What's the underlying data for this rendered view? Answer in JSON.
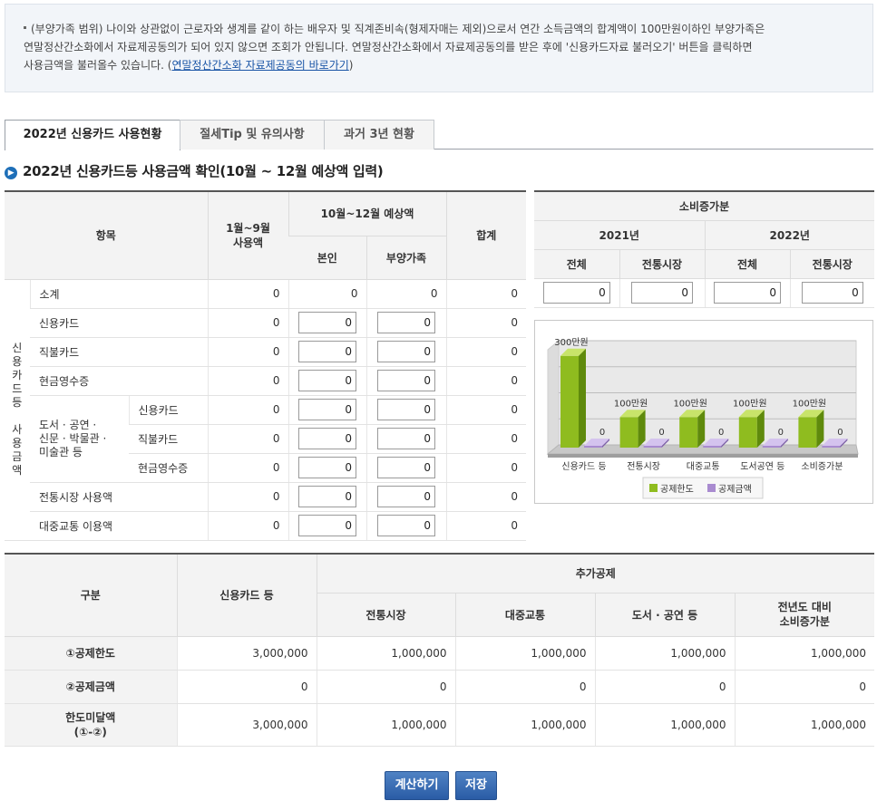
{
  "notice": {
    "line1": "(부양가족 범위) 나이와 상관없이 근로자와 생계를 같이 하는 배우자 및 직계존비속(형제자매는 제외)으로서 연간 소득금액의 합계액이 100만원이하인 부양가족은",
    "line2": "연말정산간소화에서 자료제공동의가 되어 있지 않으면 조회가 안됩니다. 연말정산간소화에서 자료제공동의를 받은 후에 '신용카드자료 불러오기' 버튼을 클릭하면",
    "line3_prefix": "사용금액을 불러올수 있습니다. (",
    "link": "연말정산간소화 자료제공동의 바로가기",
    "line3_suffix": ")"
  },
  "tabs": [
    {
      "label": "2022년 신용카드 사용현황",
      "active": true
    },
    {
      "label": "절세Tip 및 유의사항",
      "active": false
    },
    {
      "label": "과거 3년 현황",
      "active": false
    }
  ],
  "section_title": "2022년 신용카드등 사용금액 확인(10월 ~ 12월 예상액 입력)",
  "usage_table": {
    "headers": {
      "item": "항목",
      "jan_sep": "1월~9월 사용액",
      "oct_dec": "10월~12월 예상액",
      "self": "본인",
      "dependents": "부양가족",
      "total": "합계"
    },
    "group_label": "신용카드등 사용금액",
    "sub_group_label": "도서 · 공연 · 신문 · 박물관 · 미술관 등",
    "rows": {
      "subtotal": {
        "label": "소계",
        "jan_sep": "0",
        "self": "0",
        "dep": "0",
        "total": "0"
      },
      "credit": {
        "label": "신용카드",
        "jan_sep": "0",
        "self": "0",
        "dep": "0",
        "total": "0"
      },
      "debit": {
        "label": "직불카드",
        "jan_sep": "0",
        "self": "0",
        "dep": "0",
        "total": "0"
      },
      "cash": {
        "label": "현금영수증",
        "jan_sep": "0",
        "self": "0",
        "dep": "0",
        "total": "0"
      },
      "culture_credit": {
        "label": "신용카드",
        "jan_sep": "0",
        "self": "0",
        "dep": "0",
        "total": "0"
      },
      "culture_debit": {
        "label": "직불카드",
        "jan_sep": "0",
        "self": "0",
        "dep": "0",
        "total": "0"
      },
      "culture_cash": {
        "label": "현금영수증",
        "jan_sep": "0",
        "self": "0",
        "dep": "0",
        "total": "0"
      },
      "market": {
        "label": "전통시장 사용액",
        "jan_sep": "0",
        "self": "0",
        "dep": "0",
        "total": "0"
      },
      "transit": {
        "label": "대중교통 이용액",
        "jan_sep": "0",
        "self": "0",
        "dep": "0",
        "total": "0"
      }
    }
  },
  "increase_table": {
    "title": "소비증가분",
    "year1": "2021년",
    "year2": "2022년",
    "col_total": "전체",
    "col_market": "전통시장",
    "values": [
      "0",
      "0",
      "0",
      "0"
    ]
  },
  "chart_data": {
    "type": "bar",
    "categories": [
      "신용카드 등",
      "전통시장",
      "대중교통",
      "도서공연 등",
      "소비증가분"
    ],
    "series": [
      {
        "name": "공제한도",
        "values": [
          300,
          100,
          100,
          100,
          100
        ],
        "labels": [
          "300만원",
          "100만원",
          "100만원",
          "100만원",
          "100만원"
        ],
        "color": "#8fbc1f"
      },
      {
        "name": "공제금액",
        "values": [
          0,
          0,
          0,
          0,
          0
        ],
        "labels": [
          "0",
          "0",
          "0",
          "0",
          "0"
        ],
        "color": "#a98bd0"
      }
    ],
    "ylim": [
      0,
      300
    ],
    "legend": "bottom-center",
    "grid": true
  },
  "deduction_table": {
    "header_category": "구분",
    "header_credit": "신용카드 등",
    "header_additional": "추가공제",
    "header_market": "전통시장",
    "header_transit": "대중교통",
    "header_culture": "도서 · 공연 등",
    "header_increase_1": "전년도 대비",
    "header_increase_2": "소비증가분",
    "rows": [
      {
        "label": "①공제한도",
        "values": [
          "3,000,000",
          "1,000,000",
          "1,000,000",
          "1,000,000",
          "1,000,000"
        ]
      },
      {
        "label": "②공제금액",
        "values": [
          "0",
          "0",
          "0",
          "0",
          "0"
        ]
      },
      {
        "label_1": "한도미달액",
        "label_2": "(①-②)",
        "values": [
          "3,000,000",
          "1,000,000",
          "1,000,000",
          "1,000,000",
          "1,000,000"
        ]
      }
    ]
  },
  "buttons": {
    "calculate": "계산하기",
    "save": "저장"
  }
}
